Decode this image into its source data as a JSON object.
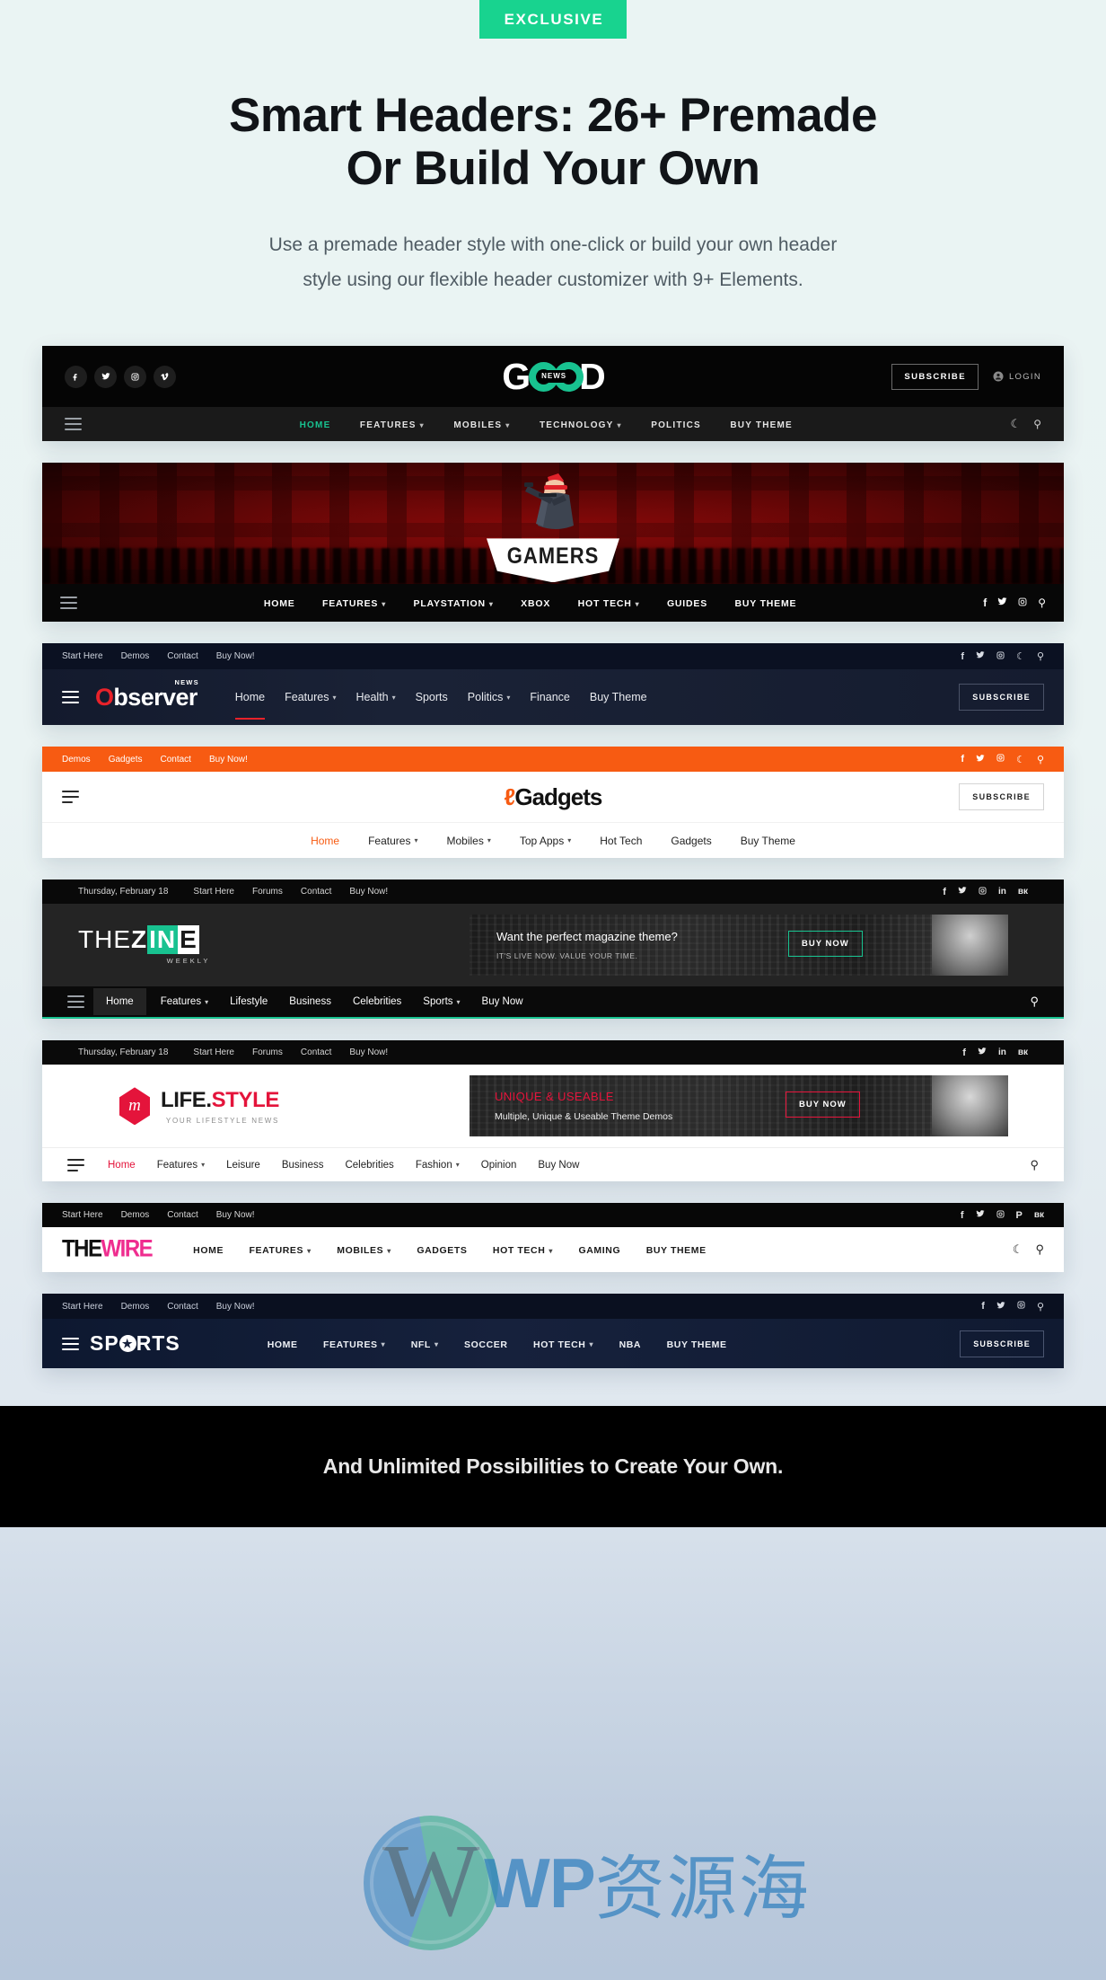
{
  "hero": {
    "badge": "EXCLUSIVE",
    "title_line1": "Smart Headers: 26+ Premade",
    "title_line2": "Or Build Your Own",
    "subtitle_line1": "Use a premade header style with one-click or build your own header",
    "subtitle_line2": "style using our flexible header customizer with 9+ Elements.",
    "badge_color": "#18d38f"
  },
  "good": {
    "logo": {
      "g": "G",
      "d": "D",
      "chip": "NEWS"
    },
    "socials": [
      "facebook-icon",
      "twitter-icon",
      "instagram-icon",
      "vimeo-icon"
    ],
    "subscribe": "SUBSCRIBE",
    "login": "LOGIN",
    "nav": [
      {
        "label": "HOME",
        "caret": false,
        "active": true
      },
      {
        "label": "FEATURES",
        "caret": true,
        "active": false
      },
      {
        "label": "MOBILES",
        "caret": true,
        "active": false
      },
      {
        "label": "TECHNOLOGY",
        "caret": true,
        "active": false
      },
      {
        "label": "POLITICS",
        "caret": false,
        "active": false
      },
      {
        "label": "BUY THEME",
        "caret": false,
        "active": false
      }
    ],
    "accent": "#18c290"
  },
  "gamers": {
    "logo": "GAMERS",
    "nav": [
      {
        "label": "HOME",
        "caret": false
      },
      {
        "label": "FEATURES",
        "caret": true
      },
      {
        "label": "PLAYSTATION",
        "caret": true
      },
      {
        "label": "XBOX",
        "caret": false
      },
      {
        "label": "HOT TECH",
        "caret": true
      },
      {
        "label": "GUIDES",
        "caret": false
      },
      {
        "label": "BUY THEME",
        "caret": false
      }
    ],
    "socials": [
      "facebook-icon",
      "twitter-icon",
      "instagram-icon",
      "search-icon"
    ]
  },
  "observer": {
    "toplinks": [
      "Start Here",
      "Demos",
      "Contact",
      "Buy Now!"
    ],
    "topicons": [
      "facebook-icon",
      "twitter-icon",
      "instagram-icon",
      "moon-icon",
      "search-icon"
    ],
    "logo": {
      "o": "O",
      "rest": "bserver",
      "news": "NEWS"
    },
    "nav": [
      {
        "label": "Home",
        "caret": false,
        "active": true
      },
      {
        "label": "Features",
        "caret": true,
        "active": false
      },
      {
        "label": "Health",
        "caret": true,
        "active": false
      },
      {
        "label": "Sports",
        "caret": false,
        "active": false
      },
      {
        "label": "Politics",
        "caret": true,
        "active": false
      },
      {
        "label": "Finance",
        "caret": false,
        "active": false
      },
      {
        "label": "Buy Theme",
        "caret": false,
        "active": false
      }
    ],
    "subscribe": "SUBSCRIBE",
    "accent": "#e8222a"
  },
  "gadgets": {
    "toplinks": [
      "Demos",
      "Gadgets",
      "Contact",
      "Buy Now!"
    ],
    "topicons": [
      "facebook-icon",
      "twitter-icon",
      "instagram-icon",
      "moon-icon",
      "search-icon"
    ],
    "logo": {
      "i": "ℓ",
      "rest": "Gadgets"
    },
    "subscribe": "SUBSCRIBE",
    "nav": [
      {
        "label": "Home",
        "caret": false,
        "active": true
      },
      {
        "label": "Features",
        "caret": true,
        "active": false
      },
      {
        "label": "Mobiles",
        "caret": true,
        "active": false
      },
      {
        "label": "Top Apps",
        "caret": true,
        "active": false
      },
      {
        "label": "Hot Tech",
        "caret": false,
        "active": false
      },
      {
        "label": "Gadgets",
        "caret": false,
        "active": false
      },
      {
        "label": "Buy Theme",
        "caret": false,
        "active": false
      }
    ],
    "accent": "#f75b12"
  },
  "zine": {
    "date": "Thursday, February 18",
    "toplinks": [
      "Start Here",
      "Forums",
      "Contact",
      "Buy Now!"
    ],
    "topicons": [
      "facebook-icon",
      "twitter-icon",
      "instagram-icon",
      "linkedin-icon",
      "vk-icon"
    ],
    "logo": {
      "the": "THE",
      "z": "Z",
      "in": "IN",
      "e": "E",
      "sub": "WEEKLY"
    },
    "ad": {
      "title": "Want the perfect magazine theme?",
      "subtitle": "IT'S LIVE NOW. VALUE YOUR TIME.",
      "button": "BUY NOW"
    },
    "nav": [
      {
        "label": "Home",
        "caret": false,
        "active": true
      },
      {
        "label": "Features",
        "caret": true,
        "active": false
      },
      {
        "label": "Lifestyle",
        "caret": false,
        "active": false
      },
      {
        "label": "Business",
        "caret": false,
        "active": false
      },
      {
        "label": "Celebrities",
        "caret": false,
        "active": false
      },
      {
        "label": "Sports",
        "caret": true,
        "active": false
      },
      {
        "label": "Buy Now",
        "caret": false,
        "active": false
      }
    ],
    "accent": "#18c290"
  },
  "lifestyle": {
    "date": "Thursday, February 18",
    "toplinks": [
      "Start Here",
      "Forums",
      "Contact",
      "Buy Now!"
    ],
    "topicons": [
      "facebook-icon",
      "twitter-icon",
      "linkedin-icon",
      "vk-icon"
    ],
    "logo": {
      "mark": "m",
      "life": "LIFE.",
      "style": "STYLE",
      "sub": "YOUR LIFESTYLE NEWS"
    },
    "ad": {
      "title": "UNIQUE & USEABLE",
      "subtitle": "Multiple, Unique & Useable Theme Demos",
      "button": "BUY NOW"
    },
    "nav": [
      {
        "label": "Home",
        "caret": false,
        "active": true
      },
      {
        "label": "Features",
        "caret": true,
        "active": false
      },
      {
        "label": "Leisure",
        "caret": false,
        "active": false
      },
      {
        "label": "Business",
        "caret": false,
        "active": false
      },
      {
        "label": "Celebrities",
        "caret": false,
        "active": false
      },
      {
        "label": "Fashion",
        "caret": true,
        "active": false
      },
      {
        "label": "Opinion",
        "caret": false,
        "active": false
      },
      {
        "label": "Buy Now",
        "caret": false,
        "active": false
      }
    ],
    "accent": "#e4143b"
  },
  "wire": {
    "toplinks": [
      "Start Here",
      "Demos",
      "Contact",
      "Buy Now!"
    ],
    "topicons": [
      "facebook-icon",
      "twitter-icon",
      "instagram-icon",
      "pinterest-icon",
      "vk-icon"
    ],
    "logo": {
      "the": "THE",
      "wire": "WIRE"
    },
    "nav": [
      {
        "label": "HOME",
        "caret": false
      },
      {
        "label": "FEATURES",
        "caret": true
      },
      {
        "label": "MOBILES",
        "caret": true
      },
      {
        "label": "GADGETS",
        "caret": false
      },
      {
        "label": "HOT TECH",
        "caret": true
      },
      {
        "label": "GAMING",
        "caret": false
      },
      {
        "label": "BUY THEME",
        "caret": false
      }
    ],
    "righticons": [
      "moon-icon",
      "search-icon"
    ],
    "accent": "#ef2d8f"
  },
  "sports": {
    "toplinks": [
      "Start Here",
      "Demos",
      "Contact",
      "Buy Now!"
    ],
    "topicons": [
      "facebook-icon",
      "twitter-icon",
      "instagram-icon",
      "search-icon"
    ],
    "logo": {
      "sp": "SP",
      "rts": "RTS"
    },
    "nav": [
      {
        "label": "HOME",
        "caret": false
      },
      {
        "label": "FEATURES",
        "caret": true
      },
      {
        "label": "NFL",
        "caret": true
      },
      {
        "label": "SOCCER",
        "caret": false
      },
      {
        "label": "HOT TECH",
        "caret": true
      },
      {
        "label": "NBA",
        "caret": false
      },
      {
        "label": "BUY THEME",
        "caret": false
      }
    ],
    "subscribe": "SUBSCRIBE"
  },
  "footer": {
    "text": "And Unlimited Possibilities to Create Your Own."
  },
  "watermark": {
    "wp": "WP",
    "cn": "资源海"
  }
}
